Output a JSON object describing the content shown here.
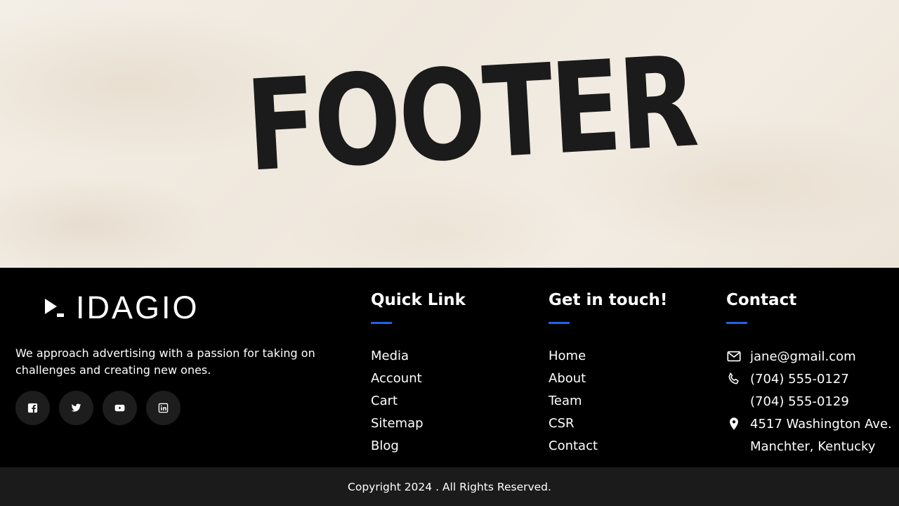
{
  "hero": {
    "title": "FOOTER"
  },
  "brand": {
    "logo_text": "IDAGIO",
    "description": "We approach advertising with a passion for taking on challenges and creating new ones.",
    "socials": [
      {
        "icon": "facebook-icon"
      },
      {
        "icon": "twitter-icon"
      },
      {
        "icon": "youtube-icon"
      },
      {
        "icon": "linkedin-icon"
      }
    ]
  },
  "quick_link": {
    "title": "Quick Link",
    "items": [
      "Media",
      "Account",
      "Cart",
      "Sitemap",
      "Blog"
    ]
  },
  "get_in_touch": {
    "title": "Get in touch!",
    "items": [
      "Home",
      "About",
      "Team",
      "CSR",
      "Contact"
    ]
  },
  "contact": {
    "title": "Contact",
    "email": "jane@gmail.com",
    "phone_1": "(704) 555-0127",
    "phone_2": "(704) 555-0129",
    "address_line_1": "4517 Washington Ave.",
    "address_line_2": "Manchter, Kentucky"
  },
  "bottom_bar": {
    "copyright": "Copyright 2024 . All Rights Reserved."
  },
  "colors": {
    "accent": "#1e63e9",
    "footer_bg": "#000000",
    "bottom_bar_bg": "#1b1b1b",
    "hero_text": "#1b1b1b",
    "hero_bg": "#f0eae0"
  }
}
